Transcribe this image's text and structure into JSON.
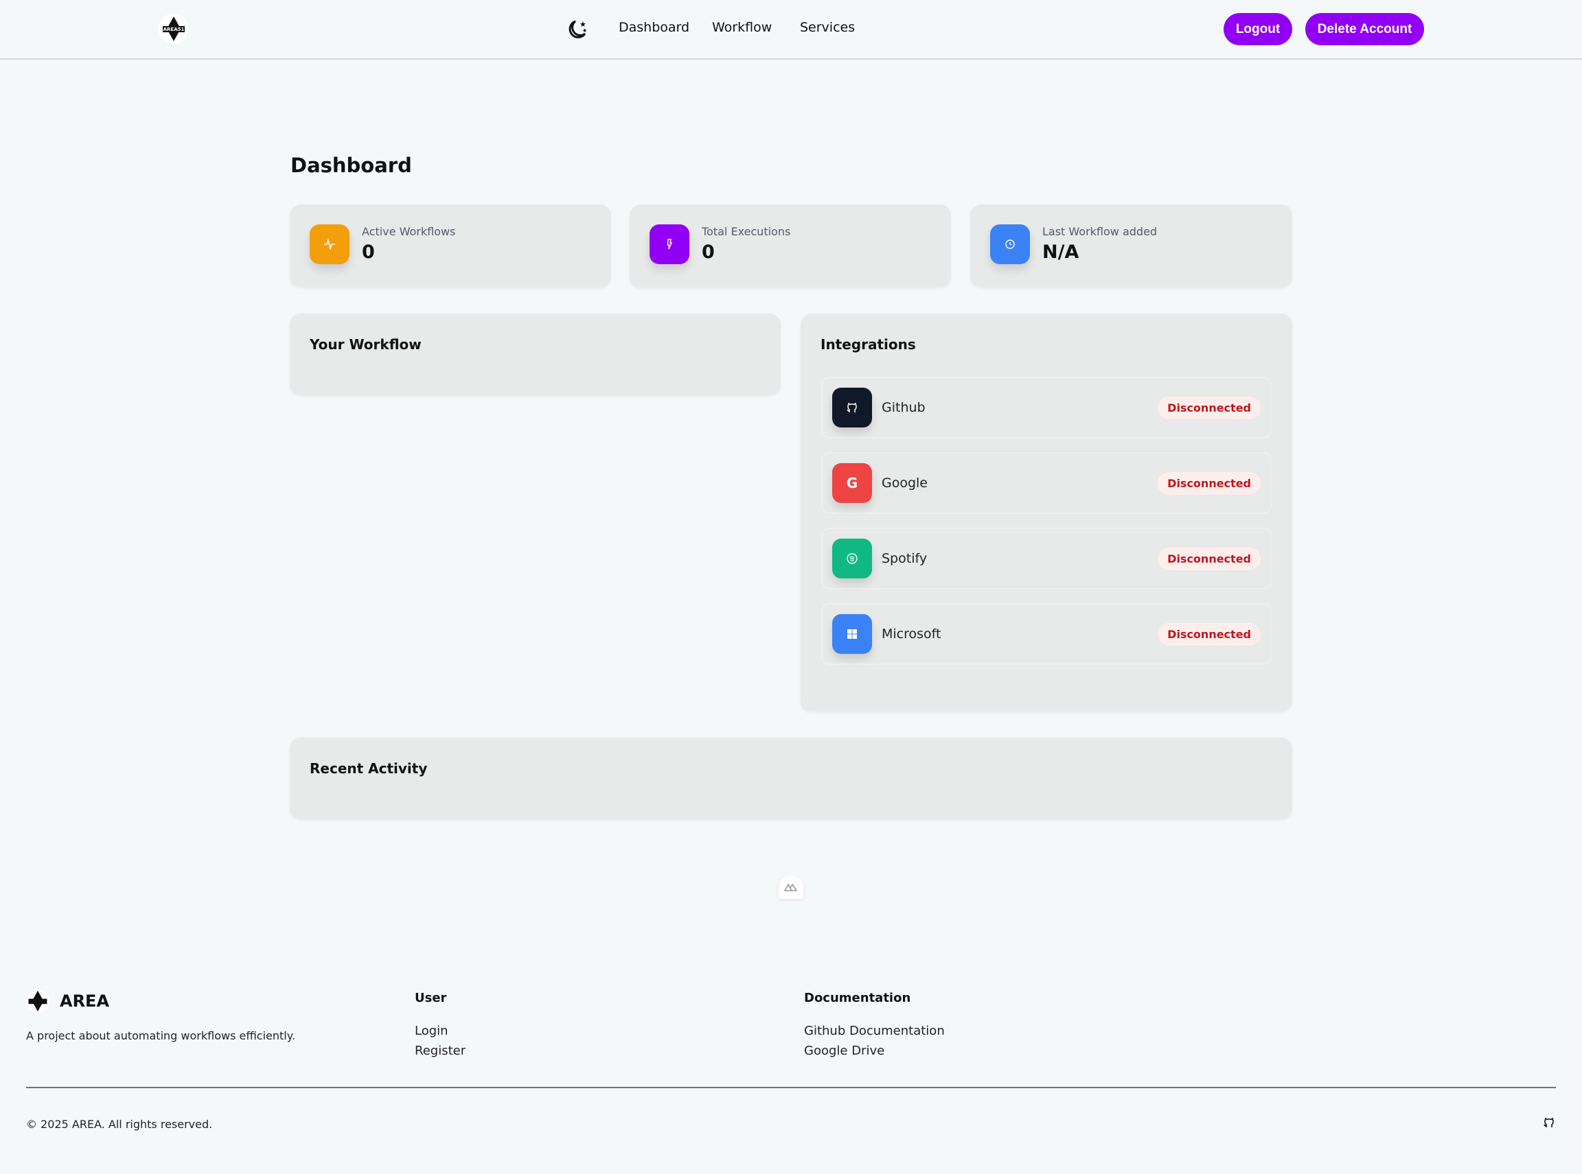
{
  "nav": {
    "logo_text": "AREA51",
    "links": [
      "Dashboard",
      "Workflow",
      "Services"
    ],
    "logout": "Logout",
    "delete_account": "Delete Account"
  },
  "page_title": "Dashboard",
  "stats": [
    {
      "label": "Active Workflows",
      "value": "0",
      "color": "#f59e0b",
      "icon": "activity-icon"
    },
    {
      "label": "Total Executions",
      "value": "0",
      "color": "#9100f5",
      "icon": "bolt-icon"
    },
    {
      "label": "Last Workflow added",
      "value": "N/A",
      "color": "#3b82f6",
      "icon": "clock-icon"
    }
  ],
  "workflow": {
    "title": "Your Workflow"
  },
  "integrations": {
    "title": "Integrations",
    "items": [
      {
        "name": "Github",
        "status": "Disconnected",
        "color": "#111827"
      },
      {
        "name": "Google",
        "status": "Disconnected",
        "color": "#ef4444"
      },
      {
        "name": "Spotify",
        "status": "Disconnected",
        "color": "#10b981"
      },
      {
        "name": "Microsoft",
        "status": "Disconnected",
        "color": "#3b82f6"
      }
    ]
  },
  "recent": {
    "title": "Recent Activity"
  },
  "footer": {
    "brand": "AREA",
    "description": "A project about automating workflows efficiently.",
    "user": {
      "title": "User",
      "links": [
        "Login",
        "Register"
      ]
    },
    "docs": {
      "title": "Documentation",
      "links": [
        "Github Documentation",
        "Google Drive"
      ]
    },
    "copyright": "© 2025 AREA. All rights reserved."
  }
}
